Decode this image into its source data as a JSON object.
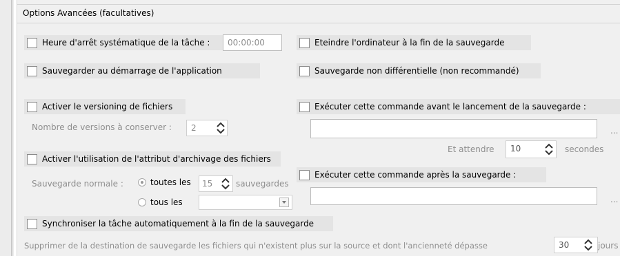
{
  "section_title": "Options Avancées (facultatives)",
  "left": {
    "stop_time": {
      "label": "Heure d'arrêt systématique de la tâche :",
      "value": "00:00:00"
    },
    "backup_at_startup": {
      "label": "Sauvegarder au démarrage de l'application"
    },
    "versioning": {
      "label": "Activer le versioning de fichiers",
      "count_label": "Nombre de versions à conserver :",
      "count_value": "2"
    },
    "archive_attr": {
      "label": "Activer l'utilisation de l'attribut d'archivage des fichiers",
      "normal_label": "Sauvegarde normale :",
      "every_label": "toutes les",
      "every_value": "15",
      "every_unit": "sauvegardes",
      "on_label": "tous les",
      "on_value": "",
      "selected": "toutes les"
    },
    "sync": {
      "label": "Synchroniser la tâche automatiquement à la fin de la sauvegarde"
    },
    "delete_row": {
      "label": "Supprimer de la destination de sauvegarde les fichiers qui n'existent plus sur la source et dont l'ancienneté dépasse",
      "value": "30",
      "unit": "jours"
    }
  },
  "right": {
    "shutdown": {
      "label": "Eteindre l'ordinateur à la fin de la sauvegarde"
    },
    "non_diff": {
      "label": "Sauvegarde non différentielle (non recommandé)"
    },
    "cmd_before": {
      "label": "Exécuter cette commande avant le lancement de la sauvegarde :",
      "value": "",
      "browse": "...",
      "wait_label": "Et attendre",
      "wait_value": "10",
      "wait_unit": "secondes"
    },
    "cmd_after": {
      "label": "Exécuter cette commande après la sauvegarde :",
      "value": "",
      "browse": "..."
    }
  }
}
